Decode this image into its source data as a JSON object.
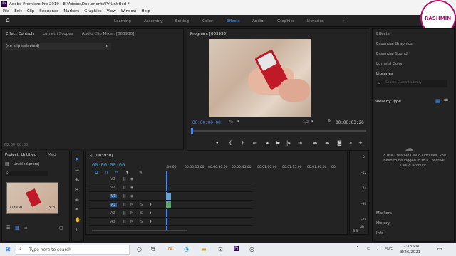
{
  "app_title": "Adobe Premiere Pro 2019 - E:\\Adobe\\Documents\\Pr\\Untitled *",
  "app_badge": "Pr",
  "menu": [
    "File",
    "Edit",
    "Clip",
    "Sequence",
    "Markers",
    "Graphics",
    "View",
    "Window",
    "Help"
  ],
  "workspaces": [
    "Learning",
    "Assembly",
    "Editing",
    "Color",
    "Effects",
    "Audio",
    "Graphics",
    "Libraries"
  ],
  "active_workspace": "Effects",
  "overflow": "»",
  "effect_controls": {
    "tabs": [
      "Effect Controls",
      "Lumetri Scopes",
      "Audio Clip Mixer: [003930]"
    ],
    "no_clip": "(no clip selected)",
    "timecode": "00:00:00:00"
  },
  "program": {
    "title": "Program: [003930]",
    "timecode": "00:00:00:00",
    "fit": "Fit",
    "quality": "1/2",
    "duration": "00:00:03:20"
  },
  "right_panel": {
    "items": [
      "Effects",
      "Essential Graphics",
      "Essential Sound",
      "Lumetri Color",
      "Libraries"
    ],
    "search_placeholder": "Search Current Library",
    "view_by": "View by Type",
    "cc_message": "To use Creative Cloud Libraries, you need to be logged in to a Creative Cloud account.",
    "bottom_items": [
      "Markers",
      "History",
      "Info"
    ]
  },
  "project": {
    "tabs": [
      "Project: Untitled",
      "Med"
    ],
    "filename": "Untitled.prproj",
    "clip_name": "003930",
    "clip_duration": "3:20"
  },
  "timeline": {
    "title": "[003930]",
    "timecode": "00:00:00:00",
    "ruler": [
      ":00:00",
      "00:00:15:00",
      "00:00:30:00",
      "00:00:45:00",
      "00:01:00:00",
      "00:01:15:00",
      "00:01:30:00",
      "00"
    ],
    "tracks": [
      {
        "name": "V3"
      },
      {
        "name": "V2"
      },
      {
        "name": "V1",
        "hl": true
      },
      {
        "name": "A1",
        "hl": true
      },
      {
        "name": "A2"
      },
      {
        "name": "A3"
      }
    ],
    "meter_labels": [
      "0",
      "-12",
      "-24",
      "-36",
      "-48"
    ],
    "meter_unit": "dB",
    "meter_s": "S S"
  },
  "taskbar": {
    "search_placeholder": "Type here to search",
    "time": "2:13 PM",
    "date": "8/26/2021",
    "lang": "ENG"
  },
  "watermark": "RASHMIN",
  "colors": {
    "accent": "#3d8bff",
    "panel": "#232323",
    "titlebar": "#f3f3f3"
  }
}
